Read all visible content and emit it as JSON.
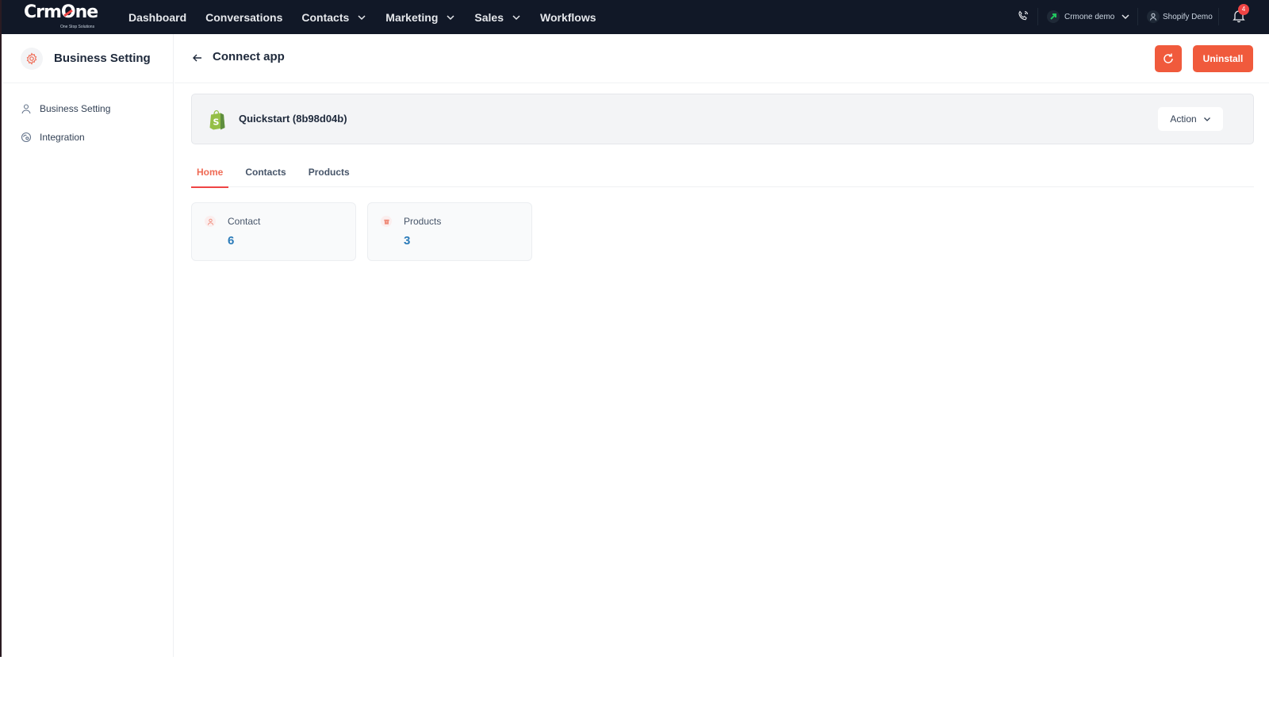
{
  "brand": {
    "name": "CrmOne",
    "tagline": "One Stop Solutions"
  },
  "nav": {
    "items": [
      {
        "label": "Dashboard",
        "has_dropdown": false
      },
      {
        "label": "Conversations",
        "has_dropdown": false
      },
      {
        "label": "Contacts",
        "has_dropdown": true
      },
      {
        "label": "Marketing",
        "has_dropdown": true
      },
      {
        "label": "Sales",
        "has_dropdown": true
      },
      {
        "label": "Workflows",
        "has_dropdown": false
      }
    ]
  },
  "topright": {
    "account_label": "Crmone demo",
    "user_label": "Shopify Demo",
    "notification_count": "4"
  },
  "sidebar": {
    "title": "Business Setting",
    "items": [
      {
        "label": "Business Setting",
        "icon": "user-icon"
      },
      {
        "label": "Integration",
        "icon": "integration-icon"
      }
    ]
  },
  "page": {
    "title": "Connect app",
    "uninstall_label": "Uninstall",
    "app_name": "Quickstart (8b98d04b)",
    "action_label": "Action",
    "tabs": [
      {
        "label": "Home",
        "active": true
      },
      {
        "label": "Contacts",
        "active": false
      },
      {
        "label": "Products",
        "active": false
      }
    ],
    "stats": [
      {
        "label": "Contact",
        "value": "6",
        "icon": "contact-icon"
      },
      {
        "label": "Products",
        "value": "3",
        "icon": "product-box-icon"
      }
    ]
  },
  "colors": {
    "topbar": "#111827",
    "accent": "#f05a3c",
    "active_tab": "#ef6b55",
    "stat_value": "#2b7bb9",
    "shopify_green": "#95bf47"
  }
}
